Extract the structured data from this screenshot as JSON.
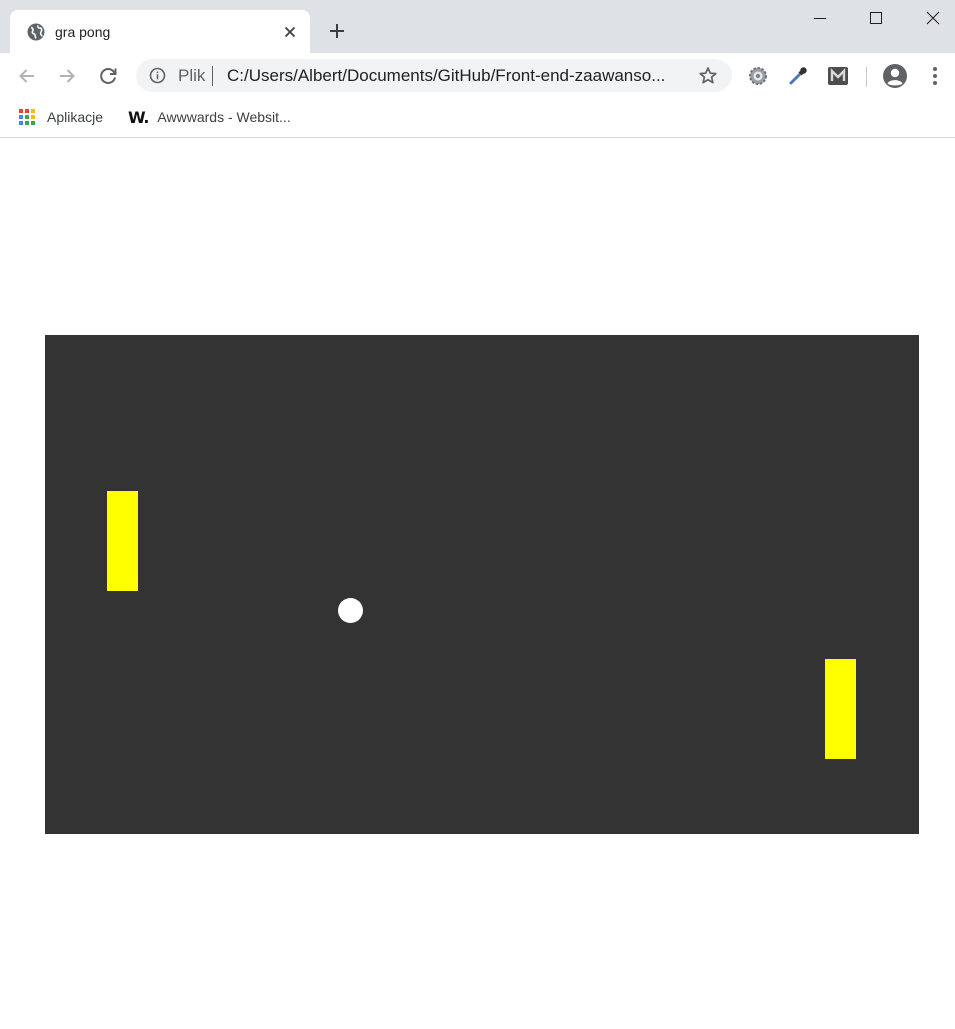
{
  "tab": {
    "title": "gra pong",
    "favicon": "globe-icon"
  },
  "toolbar": {
    "scheme": "Plik",
    "url": "C:/Users/Albert/Documents/GitHub/Front-end-zaawanso..."
  },
  "bookmarks": {
    "apps_label": "Aplikacje",
    "awwwards_logo": "W.",
    "awwwards_label": "Awwwards - Websit..."
  },
  "game": {
    "colors": {
      "background": "#333333",
      "paddle": "#ffff00",
      "ball": "#ffffff"
    }
  }
}
